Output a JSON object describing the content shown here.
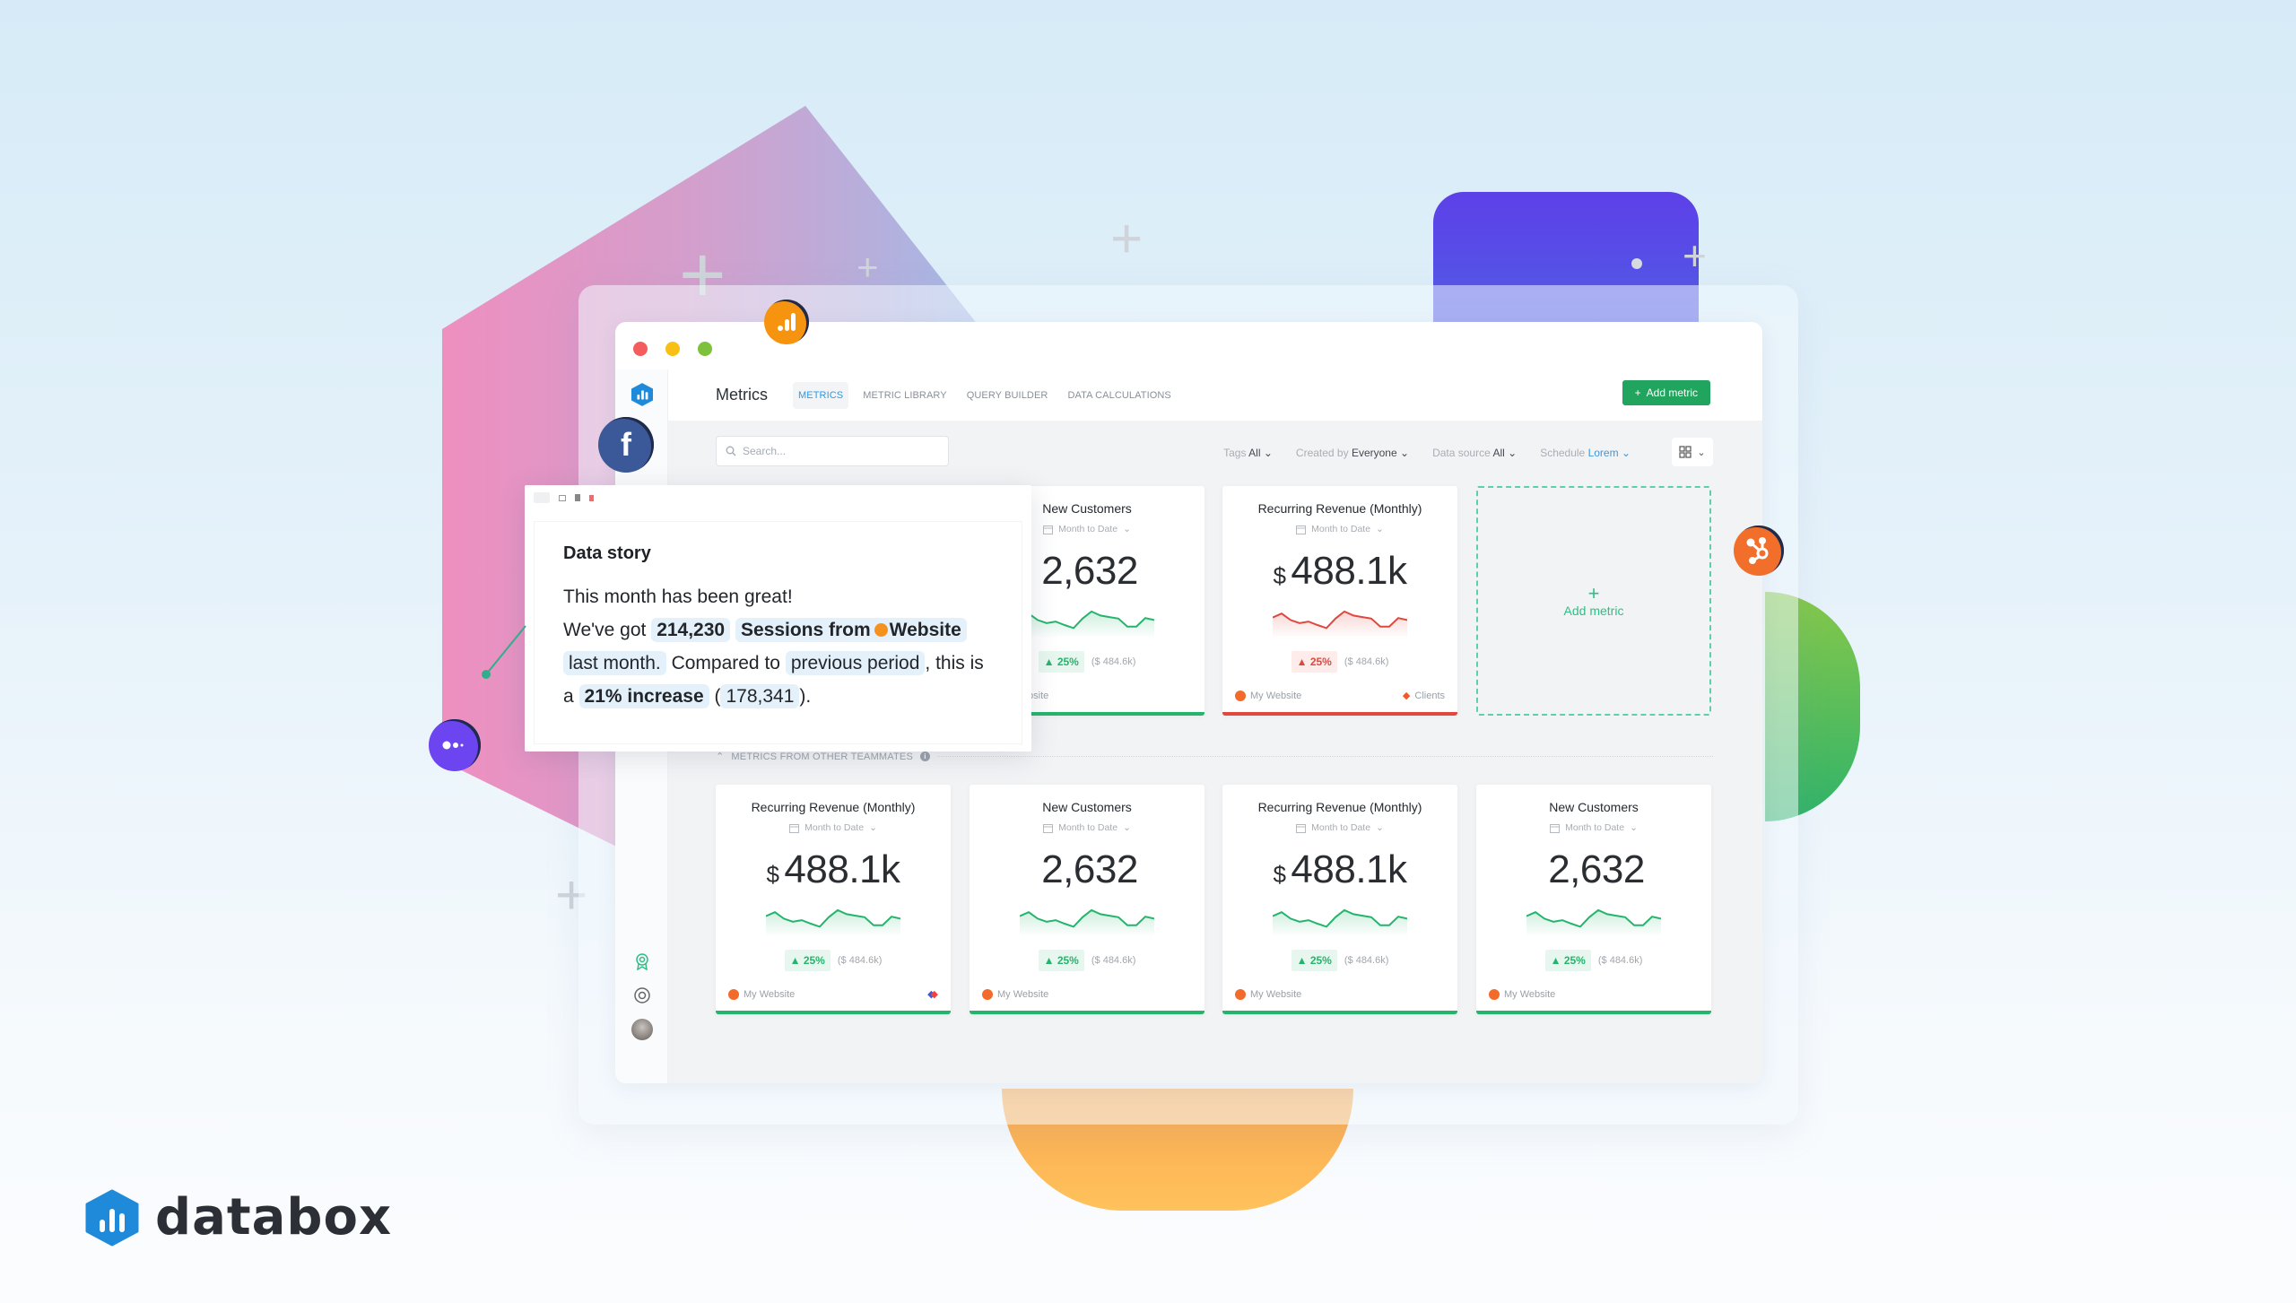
{
  "brand": {
    "name": "databox",
    "color": "#1f8ad9"
  },
  "window": {
    "traffic_lights": [
      "#f45d5d",
      "#f8c014",
      "#7ec13b"
    ],
    "page_title": "Metrics",
    "tabs": [
      {
        "label": "METRICS",
        "active": true
      },
      {
        "label": "METRIC LIBRARY",
        "active": false
      },
      {
        "label": "QUERY BUILDER",
        "active": false
      },
      {
        "label": "DATA CALCULATIONS",
        "active": false
      }
    ],
    "add_metric_label": "Add metric",
    "search_placeholder": "Search...",
    "filters": [
      {
        "label": "Tags",
        "value": "All"
      },
      {
        "label": "Created by",
        "value": "Everyone"
      },
      {
        "label": "Data source",
        "value": "All"
      },
      {
        "label": "Schedule",
        "value": "Lorem"
      }
    ],
    "section_label": "METRICS FROM OTHER TEAMMATES"
  },
  "top_cards": [
    {
      "title": "New Customers",
      "range": "Month to Date",
      "value": "2,632",
      "currency": "",
      "change": "25%",
      "previous": "($ 484.6k)",
      "trend": "up",
      "source": "My Website",
      "tag": ""
    },
    {
      "title": "Recurring Revenue (Monthly)",
      "range": "Month to Date",
      "value": "488.1k",
      "currency": "$",
      "change": "25%",
      "previous": "($ 484.6k)",
      "trend": "down",
      "source": "My Website",
      "tag": "Clients"
    }
  ],
  "add_card_label": "Add metric",
  "bottom_cards": [
    {
      "title": "Recurring Revenue (Monthly)",
      "range": "Month to Date",
      "value": "488.1k",
      "currency": "$",
      "change": "25%",
      "previous": "($ 484.6k)",
      "trend": "up",
      "source": "My Website"
    },
    {
      "title": "New Customers",
      "range": "Month to Date",
      "value": "2,632",
      "currency": "",
      "change": "25%",
      "previous": "($ 484.6k)",
      "trend": "up",
      "source": "My Website"
    },
    {
      "title": "Recurring Revenue (Monthly)",
      "range": "Month to Date",
      "value": "488.1k",
      "currency": "$",
      "change": "25%",
      "previous": "($ 484.6k)",
      "trend": "up",
      "source": "My Website"
    },
    {
      "title": "New Customers",
      "range": "Month to Date",
      "value": "2,632",
      "currency": "",
      "change": "25%",
      "previous": "($ 484.6k)",
      "trend": "up",
      "source": "My Website"
    }
  ],
  "sparkline": [
    0.62,
    0.78,
    0.52,
    0.4,
    0.46,
    0.32,
    0.2,
    0.58,
    0.86,
    0.7,
    0.64,
    0.58,
    0.26,
    0.26,
    0.6,
    0.52
  ],
  "colors": {
    "up": "#25b46c",
    "down": "#e0473d"
  },
  "data_story": {
    "title": "Data story",
    "line1": "This month has been great!",
    "we_got": "We've got",
    "value": "214,230",
    "metric": "Sessions from",
    "source": "Website",
    "period": "last month.",
    "compared": "Compared to",
    "comparison": "previous period",
    "this_is_a": ", this is a",
    "increase": "21% increase",
    "previous_value": "178,341",
    "open_paren": "(",
    "close": ")."
  },
  "integrations": [
    "google-analytics",
    "facebook",
    "hubspot",
    "intercom"
  ]
}
